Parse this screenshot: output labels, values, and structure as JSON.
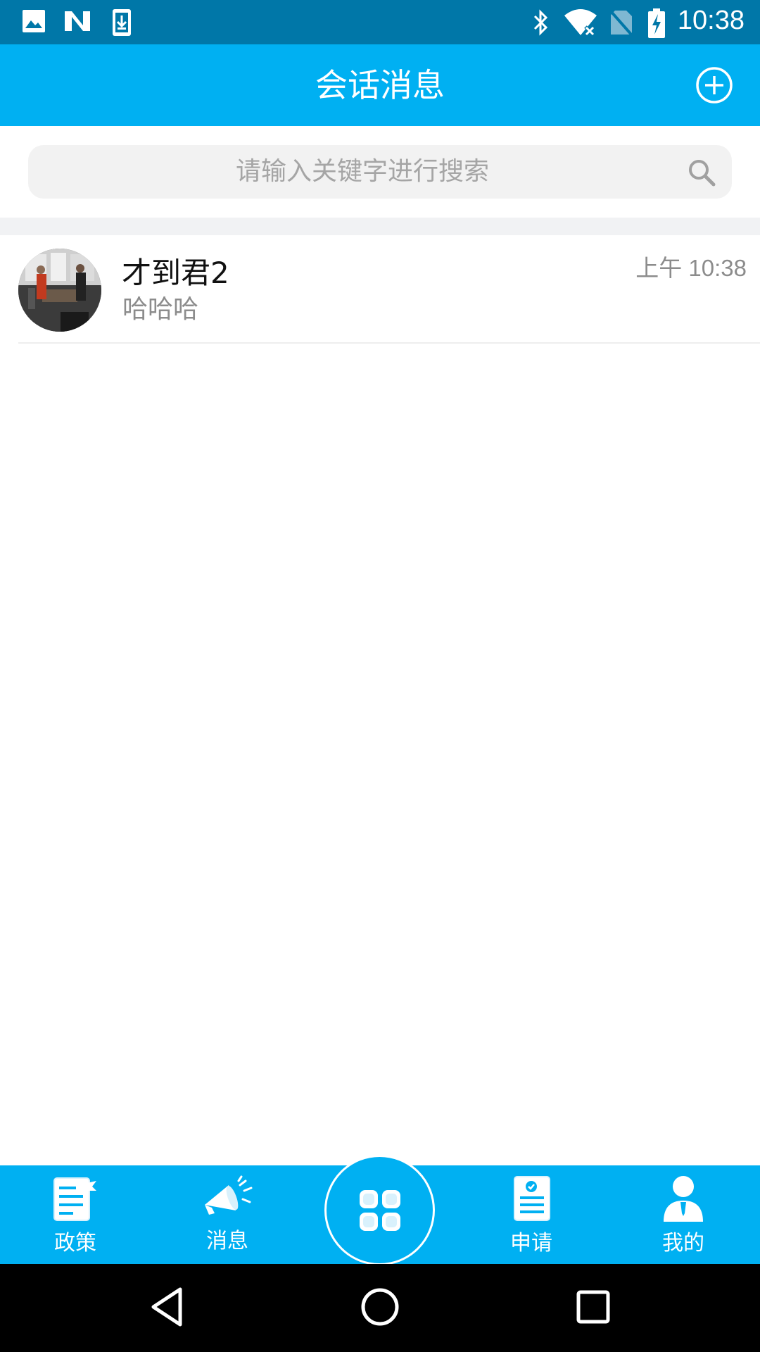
{
  "status_bar": {
    "time": "10:38",
    "left_icons": [
      "image-notification-icon",
      "n-notification-icon",
      "download-notification-icon"
    ],
    "right_icons": [
      "bluetooth-icon",
      "wifi-icon",
      "no-sim-icon",
      "battery-charging-icon"
    ]
  },
  "header": {
    "title": "会话消息",
    "add_icon": "plus-circle-icon"
  },
  "search": {
    "placeholder": "请输入关键字进行搜索",
    "icon": "search-icon"
  },
  "conversations": [
    {
      "name": "才到君2",
      "preview": "哈哈哈",
      "time": "上午 10:38",
      "avatar": "photo-avatar"
    }
  ],
  "bottom_nav": {
    "items": [
      {
        "label": "政策",
        "icon": "policy-document-icon"
      },
      {
        "label": "消息",
        "icon": "megaphone-icon"
      },
      {
        "label": "",
        "icon": "grid-apps-icon"
      },
      {
        "label": "申请",
        "icon": "application-clipboard-icon"
      },
      {
        "label": "我的",
        "icon": "user-profile-icon"
      }
    ]
  },
  "colors": {
    "status_bar": "#0077a8",
    "accent": "#00b0f2",
    "search_bg": "#f2f2f2",
    "divider": "#f1f2f4"
  }
}
